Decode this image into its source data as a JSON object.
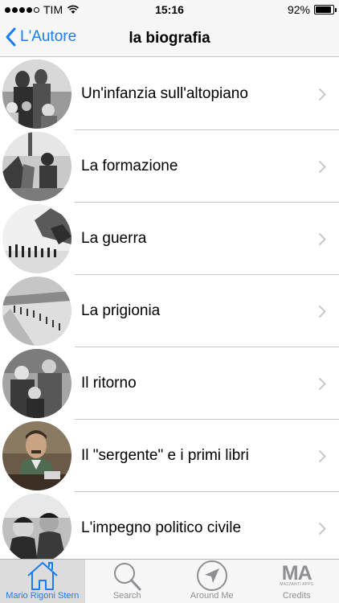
{
  "status_bar": {
    "carrier": "TIM",
    "time": "15:16",
    "battery_percent": "92%",
    "battery_level": 0.92,
    "signal_bars_filled": 4,
    "signal_bars_total": 5
  },
  "nav": {
    "back_label": "L'Autore",
    "title": "la biografia"
  },
  "list": {
    "items": [
      {
        "label": "Un'infanzia sull'altopiano",
        "thumb": "family-photo"
      },
      {
        "label": "La formazione",
        "thumb": "soldier-photo"
      },
      {
        "label": "La guerra",
        "thumb": "war-photo"
      },
      {
        "label": "La prigionia",
        "thumb": "prison-photo"
      },
      {
        "label": "Il ritorno",
        "thumb": "return-photo"
      },
      {
        "label": "Il \"sergente\" e i primi libri",
        "thumb": "writer-photo"
      },
      {
        "label": "L'impegno politico civile",
        "thumb": "politics-photo"
      }
    ]
  },
  "tab_bar": {
    "tabs": [
      {
        "label": "Mario Rigoni Stern",
        "icon": "home-icon",
        "active": true
      },
      {
        "label": "Search",
        "icon": "search-icon",
        "active": false
      },
      {
        "label": "Around Me",
        "icon": "location-arrow-icon",
        "active": false
      },
      {
        "label": "Credits",
        "icon": "ma-logo-icon",
        "active": false
      }
    ],
    "credits_logo_text": "MA",
    "credits_logo_subtext": "MAZZANTI APPS"
  },
  "colors": {
    "accent": "#1a7cf5",
    "bar_background": "#f7f7f7",
    "separator": "#c8c7cc",
    "inactive_tab": "#8e8e93"
  }
}
